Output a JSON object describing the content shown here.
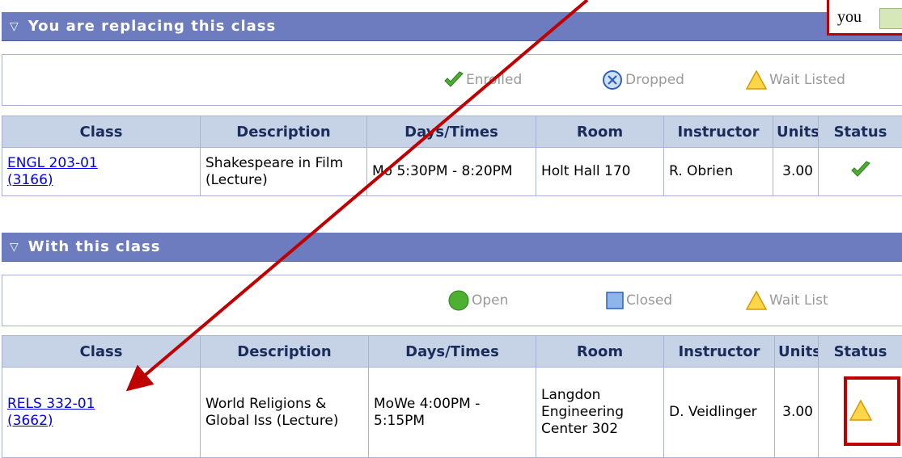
{
  "callout_top": {
    "text": "you"
  },
  "section1": {
    "title": "You are replacing this class",
    "legend": [
      {
        "icon": "check-icon",
        "label": "Enrolled"
      },
      {
        "icon": "dropped-x-icon",
        "label": "Dropped"
      },
      {
        "icon": "warning-triangle-icon",
        "label": "Wait Listed"
      }
    ],
    "columns": [
      "Class",
      "Description",
      "Days/Times",
      "Room",
      "Instructor",
      "Units",
      "Status"
    ],
    "row": {
      "class_line1": "ENGL 203-01",
      "class_line2": "(3166)",
      "description": "Shakespeare in Film (Lecture)",
      "days_times": "Mo 5:30PM - 8:20PM",
      "room": "Holt Hall 170",
      "instructor": "R. Obrien",
      "units": "3.00",
      "status_icon": "check-icon"
    }
  },
  "section2": {
    "title": "With this class",
    "legend": [
      {
        "icon": "open-circle-icon",
        "label": "Open"
      },
      {
        "icon": "closed-square-icon",
        "label": "Closed"
      },
      {
        "icon": "warning-triangle-icon",
        "label": "Wait List"
      }
    ],
    "columns": [
      "Class",
      "Description",
      "Days/Times",
      "Room",
      "Instructor",
      "Units",
      "Status"
    ],
    "row": {
      "class_line1": "RELS 332-01",
      "class_line2": "(3662)",
      "description": "World Religions & Global Iss (Lecture)",
      "days_times": "MoWe 4:00PM - 5:15PM",
      "room": "Langdon Engineering Center 302",
      "instructor": "D. Veidlinger",
      "units": "3.00",
      "status_icon": "warning-triangle-icon"
    }
  },
  "colors": {
    "header_bg": "#6c7cbf",
    "column_header_bg": "#c6d3e7",
    "annotation_red": "#c00000",
    "check_green": "#4cb030",
    "warning_orange": "#f5b400"
  }
}
